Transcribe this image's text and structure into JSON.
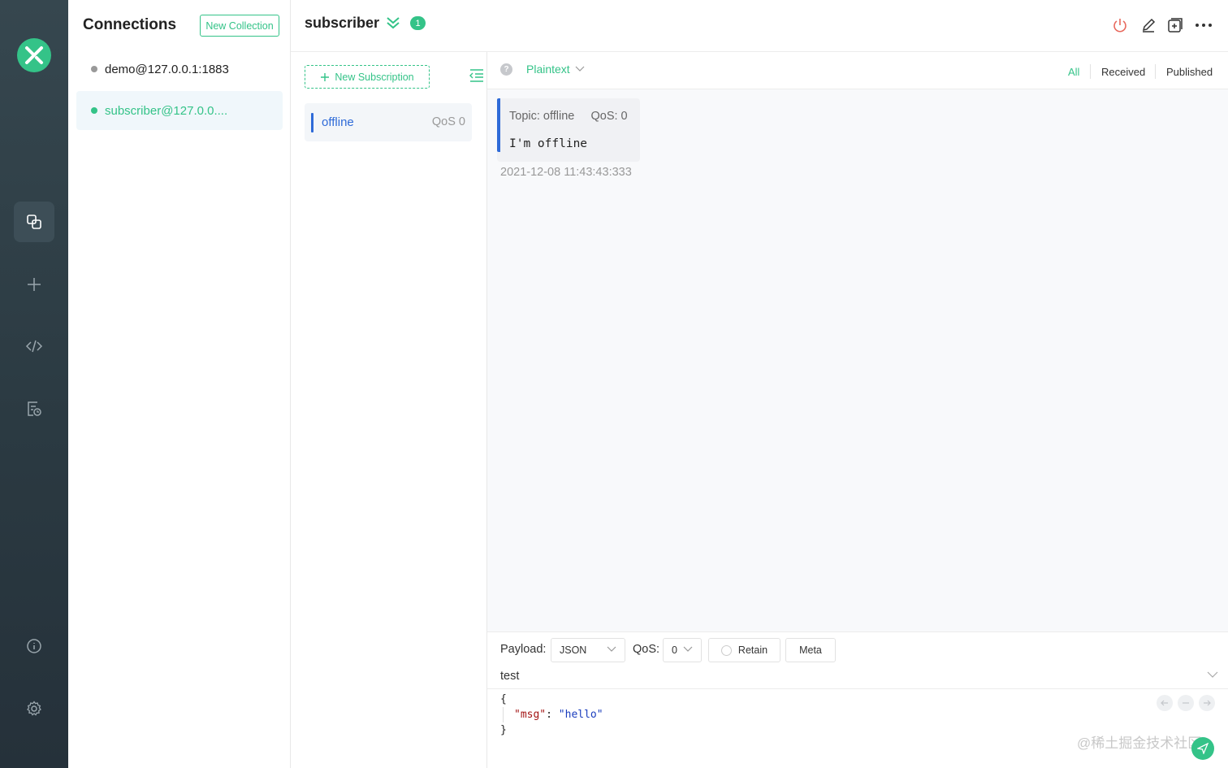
{
  "sidebar": {
    "logo": "mqttx-logo-icon",
    "nav": [
      {
        "icon": "connections-icon",
        "active": true
      },
      {
        "icon": "plus-icon"
      },
      {
        "icon": "code-icon"
      },
      {
        "icon": "log-icon"
      },
      {
        "icon": "info-icon"
      },
      {
        "icon": "gear-icon"
      }
    ]
  },
  "connections": {
    "title": "Connections",
    "new_collection_label": "New Collection",
    "items": [
      {
        "label": "demo@127.0.0.1:1883",
        "status": "offline"
      },
      {
        "label": "subscriber@127.0.0....",
        "status": "online"
      }
    ]
  },
  "header": {
    "title": "subscriber",
    "badge": "1"
  },
  "subscriptions": {
    "new_label": "New Subscription",
    "items": [
      {
        "topic": "offline",
        "qos": "QoS 0",
        "color": "#2f6bd8"
      }
    ]
  },
  "messages": {
    "help": "?",
    "format": "Plaintext",
    "filters": [
      "All",
      "Received",
      "Published"
    ],
    "list": [
      {
        "meta": "Topic: offline     QoS: 0",
        "payload": "I'm offline",
        "time": "2021-12-08 11:43:43:333"
      }
    ]
  },
  "publish": {
    "payload_label": "Payload:",
    "payload_format": "JSON",
    "qos_label": "QoS:",
    "qos_value": "0",
    "retain_label": "Retain",
    "meta_label": "Meta",
    "topic": "test",
    "code_open": "{",
    "code_key": "\"msg\"",
    "code_colon": ": ",
    "code_value": "\"hello\"",
    "code_close": "}"
  },
  "watermark": "@稀土掘金技术社区",
  "colors": {
    "accent": "#34c388",
    "topic": "#2f6bd8",
    "sidebar": "#2f3e46"
  }
}
